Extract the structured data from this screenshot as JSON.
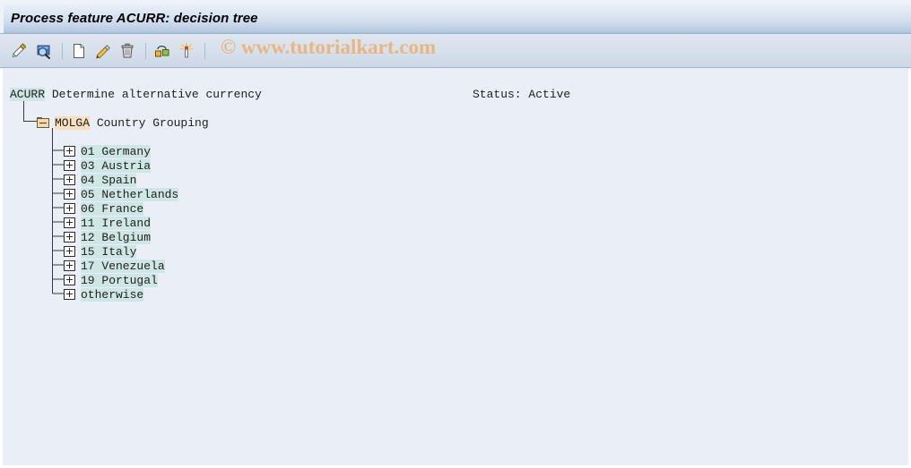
{
  "window": {
    "title": "Process feature ACURR: decision tree"
  },
  "watermark": {
    "text": "© www.tutorialkart.com"
  },
  "toolbar": {
    "buttons": [
      {
        "name": "change-mode-icon",
        "title": "Change"
      },
      {
        "name": "display-mode-icon",
        "title": "Display"
      },
      {
        "name": "create-icon",
        "title": "Create"
      },
      {
        "name": "edit-icon",
        "title": "Change node"
      },
      {
        "name": "delete-icon",
        "title": "Delete"
      },
      {
        "name": "copy-icon",
        "title": "Copy"
      },
      {
        "name": "activate-icon",
        "title": "Activate"
      }
    ]
  },
  "feature": {
    "code": "ACURR",
    "description": " Determine alternative currency",
    "status_label": "Status: Active"
  },
  "tree": {
    "group_node": {
      "code": "MOLGA",
      "description": " Country Grouping",
      "expanded": true
    },
    "children": [
      {
        "key": "01",
        "label": "01 Germany"
      },
      {
        "key": "03",
        "label": "03 Austria"
      },
      {
        "key": "04",
        "label": "04 Spain"
      },
      {
        "key": "05",
        "label": "05 Netherlands"
      },
      {
        "key": "06",
        "label": "06 France"
      },
      {
        "key": "11",
        "label": "11 Ireland"
      },
      {
        "key": "12",
        "label": "12 Belgium"
      },
      {
        "key": "15",
        "label": "15 Italy"
      },
      {
        "key": "17",
        "label": "17 Venezuela"
      },
      {
        "key": "19",
        "label": "19 Portugal"
      },
      {
        "key": "otherwise",
        "label": "otherwise"
      }
    ]
  },
  "colors": {
    "highlight_cyan": "#cfe7e4",
    "highlight_orange": "#fadfbe",
    "watermark": "#e9b682",
    "content_bg": "#eaeff7",
    "titlebar_bottom": "#a8bdd8"
  }
}
